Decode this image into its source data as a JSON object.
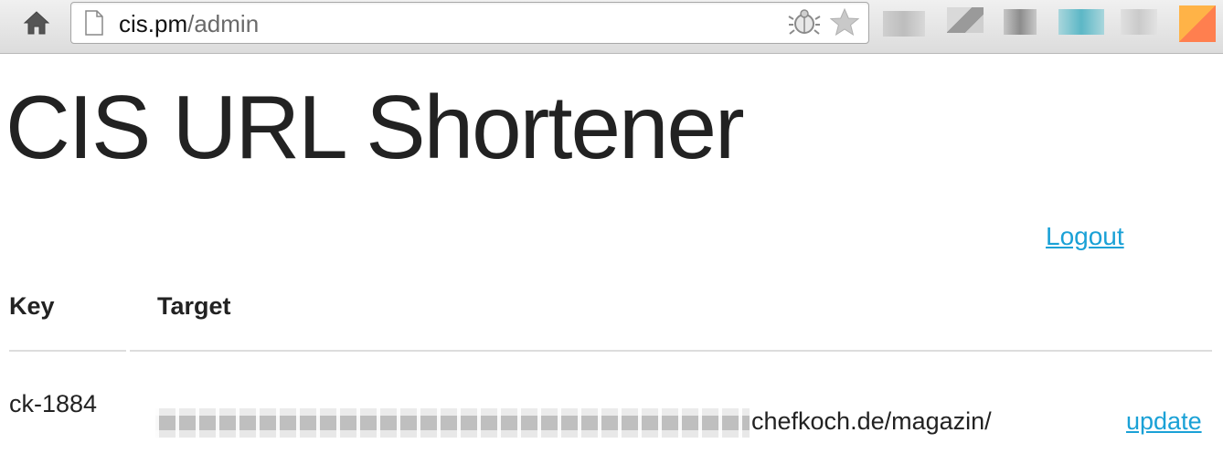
{
  "browser": {
    "url_domain": "cis.pm",
    "url_path": "/admin",
    "icons": [
      "home-icon",
      "page-icon",
      "bug-icon",
      "star-icon"
    ]
  },
  "page": {
    "title": "CIS URL Shortener",
    "logout_label": "Logout"
  },
  "table": {
    "headers": [
      "Key",
      "Target"
    ],
    "rows": [
      {
        "key": "ck-1884",
        "target_visible": "chefkoch.de/magazin/",
        "action": "update"
      }
    ]
  },
  "colors": {
    "link": "#1aa1d6",
    "text": "#222222",
    "rule": "#dddddd"
  }
}
